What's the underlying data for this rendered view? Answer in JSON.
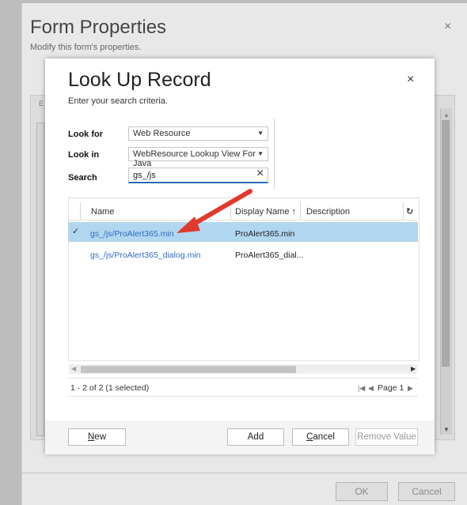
{
  "form_properties": {
    "title": "Form Properties",
    "subtitle": "Modify this form's properties.",
    "close_glyph": "×",
    "tab_letter": "E",
    "ok_label": "OK",
    "cancel_label": "Cancel"
  },
  "lookup": {
    "title": "Look Up Record",
    "subtitle": "Enter your search criteria.",
    "close_glyph": "×",
    "look_for": {
      "label": "Look for",
      "value": "Web Resource"
    },
    "look_in": {
      "label": "Look in",
      "value": "WebResource Lookup View For Java"
    },
    "search": {
      "label": "Search",
      "value": "gs_/js",
      "clear_glyph": "×"
    },
    "grid": {
      "columns": [
        "Name",
        "Display Name ↑",
        "Description"
      ],
      "rows": [
        {
          "name": "gs_/js/ProAlert365.min",
          "display_name": "ProAlert365.min",
          "selected": true
        },
        {
          "name": "gs_/js/ProAlert365_dialog.min",
          "display_name": "ProAlert365_dial...",
          "selected": false
        }
      ],
      "check_glyph": "✓",
      "refresh_glyph": "↻"
    },
    "status": {
      "summary": "1 - 2 of 2 (1 selected)",
      "page_label": "Page 1",
      "first_glyph": "|◀",
      "prev_glyph": "◀",
      "next_glyph": "▶"
    },
    "buttons": {
      "new_first": "N",
      "new_rest": "ew",
      "add": "Add",
      "cancel_first": "C",
      "cancel_rest": "ancel",
      "remove_value": "Remove Value"
    }
  },
  "colors": {
    "selected_row": "#b1d6f0",
    "link": "#2f6cc0",
    "annotation_arrow": "#e03a2f",
    "search_underline": "#2b6cb8"
  }
}
